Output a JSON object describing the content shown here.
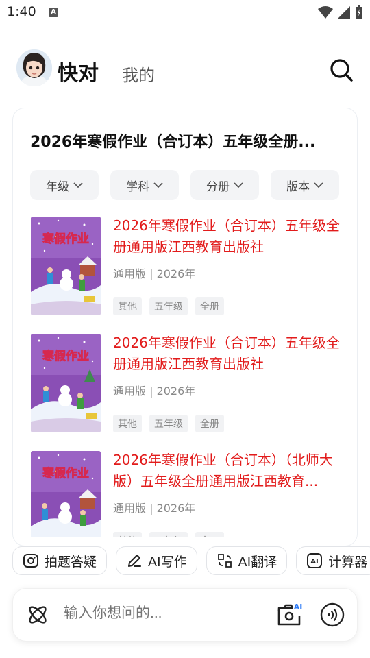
{
  "status": {
    "time": "1:40",
    "notif_letter": "A"
  },
  "header": {
    "brand": "快对",
    "mine_tab": "我的"
  },
  "card": {
    "title": "2026年寒假作业（合订本）五年级全册...",
    "filters": [
      {
        "label": "年级"
      },
      {
        "label": "学科"
      },
      {
        "label": "分册"
      },
      {
        "label": "版本"
      }
    ],
    "items": [
      {
        "title": "2026年寒假作业（合订本）五年级全册通用版江西教育出版社",
        "meta": "通用版 | 2026年",
        "tags": [
          "其他",
          "五年级",
          "全册"
        ],
        "cover_text": "寒假作业"
      },
      {
        "title": "2026年寒假作业（合订本）五年级全册通用版江西教育出版社",
        "meta": "通用版 | 2026年",
        "tags": [
          "其他",
          "五年级",
          "全册"
        ],
        "cover_text": "寒假作业"
      },
      {
        "title": "2026年寒假作业（合订本）（北师大版）五年级全册通用版江西教育...",
        "meta": "通用版 | 2026年",
        "tags": [
          "其他",
          "五年级",
          "全册"
        ],
        "cover_text": "寒假作业"
      }
    ]
  },
  "quick_actions": [
    {
      "label": "拍题答疑",
      "icon": "camera-icon"
    },
    {
      "label": "AI写作",
      "icon": "pen-icon"
    },
    {
      "label": "AI翻译",
      "icon": "translate-icon"
    },
    {
      "label": "计算器",
      "icon": "ai-calculator-icon"
    }
  ],
  "input": {
    "placeholder": "输入你想问的...",
    "camera_badge": "AI"
  },
  "colors": {
    "accent_red": "#e21b1b",
    "cover_purple": "#8a4fb5"
  }
}
